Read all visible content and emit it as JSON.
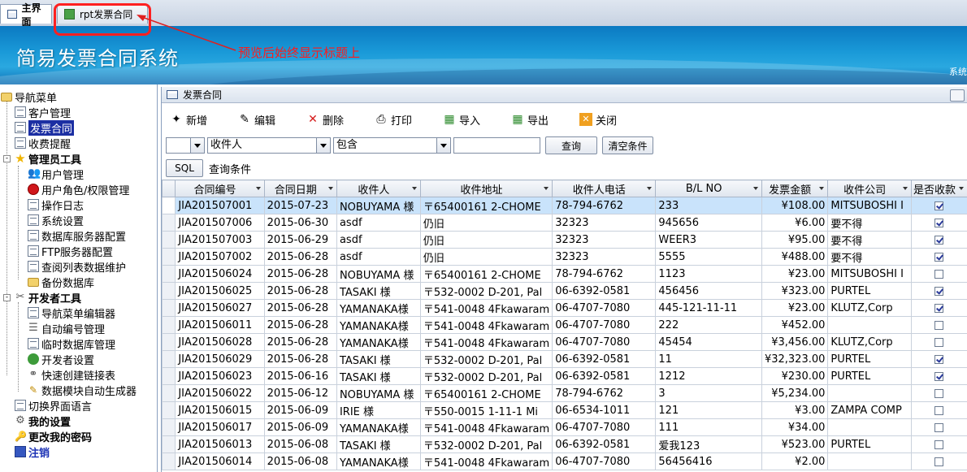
{
  "tabs": [
    {
      "label": "主界面"
    },
    {
      "label": "rpt发票合同"
    }
  ],
  "annotation": "预览后始终显示标题上",
  "app_title": "简易发票合同系统",
  "banner_right": "系统",
  "nav": {
    "root": "导航菜单",
    "items": [
      "客户管理",
      "发票合同",
      "收费提醒",
      "管理员工具",
      "用户管理",
      "用户角色/权限管理",
      "操作日志",
      "系统设置",
      "数据库服务器配置",
      "FTP服务器配置",
      "查阅列表数据维护",
      "备份数据库",
      "开发者工具",
      "导航菜单编辑器",
      "自动编号管理",
      "临时数据库管理",
      "开发者设置",
      "快速创建链接表",
      "数据模块自动生成器",
      "切换界面语言",
      "我的设置",
      "更改我的密码",
      "注销"
    ]
  },
  "form": {
    "title": "发票合同",
    "toolbar": [
      "新增",
      "编辑",
      "删除",
      "打印",
      "导入",
      "导出",
      "关闭"
    ],
    "filter": {
      "field": "收件人",
      "op": "包含",
      "value": "",
      "query_btn": "查询",
      "clear_btn": "清空条件"
    },
    "sql_btn": "SQL",
    "sql_label": "查询条件"
  },
  "grid": {
    "columns": [
      "合同编号",
      "合同日期",
      "收件人",
      "收件地址",
      "收件人电话",
      "B/L NO",
      "发票金额",
      "收件公司",
      "是否收款"
    ],
    "rows": [
      [
        "JIA201507001",
        "2015-07-23",
        "NOBUYAMA 様",
        "〒65400161 2-CHOME",
        "78-794-6762",
        "233",
        "¥108.00",
        "MITSUBOSHI I",
        true
      ],
      [
        "JIA201507006",
        "2015-06-30",
        "asdf",
        "仍旧",
        "32323",
        "945656",
        "¥6.00",
        "要不得",
        true
      ],
      [
        "JIA201507003",
        "2015-06-29",
        "asdf",
        "仍旧",
        "32323",
        "WEER3",
        "¥95.00",
        "要不得",
        true
      ],
      [
        "JIA201507002",
        "2015-06-28",
        "asdf",
        "仍旧",
        "32323",
        "5555",
        "¥488.00",
        "要不得",
        true
      ],
      [
        "JIA201506024",
        "2015-06-28",
        "NOBUYAMA 様",
        "〒65400161 2-CHOME",
        "78-794-6762",
        "1123",
        "¥23.00",
        "MITSUBOSHI I",
        false
      ],
      [
        "JIA201506025",
        "2015-06-28",
        "TASAKI 様",
        "〒532-0002 D-201, Pal",
        "06-6392-0581",
        "456456",
        "¥323.00",
        "PURTEL",
        true
      ],
      [
        "JIA201506027",
        "2015-06-28",
        "YAMANAKA様",
        "〒541-0048 4Fkawaram",
        "06-4707-7080",
        "445-121-11-11",
        "¥23.00",
        "KLUTZ,Corp",
        true
      ],
      [
        "JIA201506011",
        "2015-06-28",
        "YAMANAKA様",
        "〒541-0048 4Fkawaram",
        "06-4707-7080",
        "222",
        "¥452.00",
        "",
        false
      ],
      [
        "JIA201506028",
        "2015-06-28",
        "YAMANAKA様",
        "〒541-0048 4Fkawaram",
        "06-4707-7080",
        "45454",
        "¥3,456.00",
        "KLUTZ,Corp",
        false
      ],
      [
        "JIA201506029",
        "2015-06-28",
        "TASAKI 様",
        "〒532-0002 D-201, Pal",
        "06-6392-0581",
        "11",
        "¥32,323.00",
        "PURTEL",
        true
      ],
      [
        "JIA201506023",
        "2015-06-16",
        "TASAKI 様",
        "〒532-0002 D-201, Pal",
        "06-6392-0581",
        "1212",
        "¥230.00",
        "PURTEL",
        true
      ],
      [
        "JIA201506022",
        "2015-06-12",
        "NOBUYAMA 様",
        "〒65400161 2-CHOME",
        "78-794-6762",
        "3",
        "¥5,234.00",
        "",
        false
      ],
      [
        "JIA201506015",
        "2015-06-09",
        "IRIE 様",
        "〒550-0015 1-11-1 Mi",
        "06-6534-1011",
        "121",
        "¥3.00",
        "ZAMPA COMP",
        false
      ],
      [
        "JIA201506017",
        "2015-06-09",
        "YAMANAKA様",
        "〒541-0048 4Fkawaram",
        "06-4707-7080",
        "111",
        "¥34.00",
        "",
        false
      ],
      [
        "JIA201506013",
        "2015-06-08",
        "TASAKI 様",
        "〒532-0002 D-201, Pal",
        "06-6392-0581",
        "爱我123",
        "¥523.00",
        "PURTEL",
        false
      ],
      [
        "JIA201506014",
        "2015-06-08",
        "YAMANAKA様",
        "〒541-0048 4Fkawaram",
        "06-4707-7080",
        "56456416",
        "¥2.00",
        "",
        false
      ]
    ]
  }
}
